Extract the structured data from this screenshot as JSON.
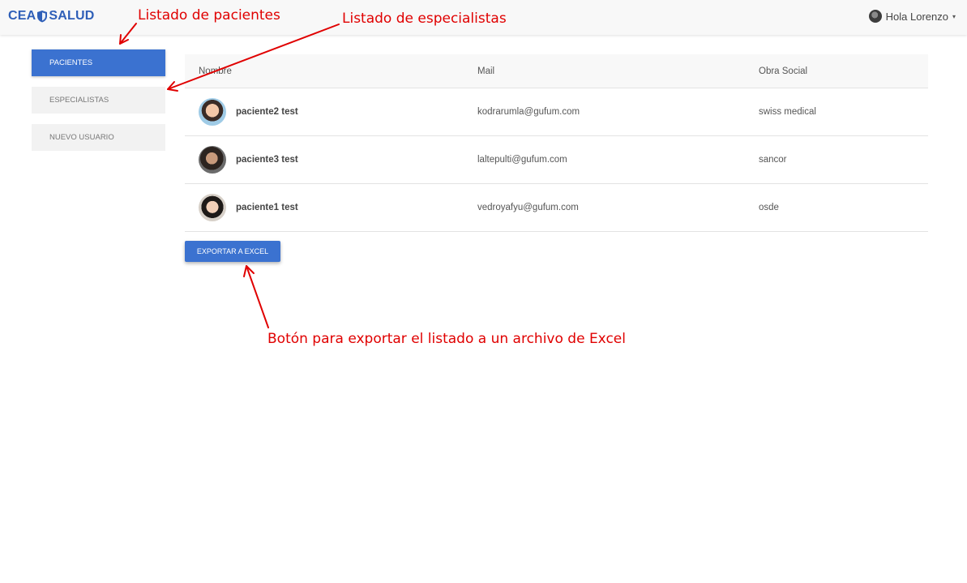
{
  "header": {
    "brand_left": "CEA",
    "brand_right": "SALUD",
    "brand_icon": "shield-icon",
    "greeting": "Hola Lorenzo",
    "caret": "▾",
    "brand_color": "#2f5fb8"
  },
  "sidebar": {
    "items": [
      {
        "label": "PACIENTES",
        "active": true
      },
      {
        "label": "ESPECIALISTAS",
        "active": false
      },
      {
        "label": "NUEVO USUARIO",
        "active": false
      }
    ],
    "accent": "#3b72d0"
  },
  "table": {
    "columns": [
      "Nombre",
      "Mail",
      "Obra Social"
    ],
    "rows": [
      {
        "name": "paciente2 test",
        "mail": "kodrarumla@gufum.com",
        "obra": "swiss medical"
      },
      {
        "name": "paciente3 test",
        "mail": "laltepulti@gufum.com",
        "obra": "sancor"
      },
      {
        "name": "paciente1 test",
        "mail": "vedroyafyu@gufum.com",
        "obra": "osde"
      }
    ]
  },
  "export_button": "EXPORTAR A EXCEL",
  "annotations": {
    "pacientes": "Listado de pacientes",
    "especialistas": "Listado de especialistas",
    "export": "Botón para exportar el listado a un archivo de Excel",
    "color": "#e00000"
  }
}
